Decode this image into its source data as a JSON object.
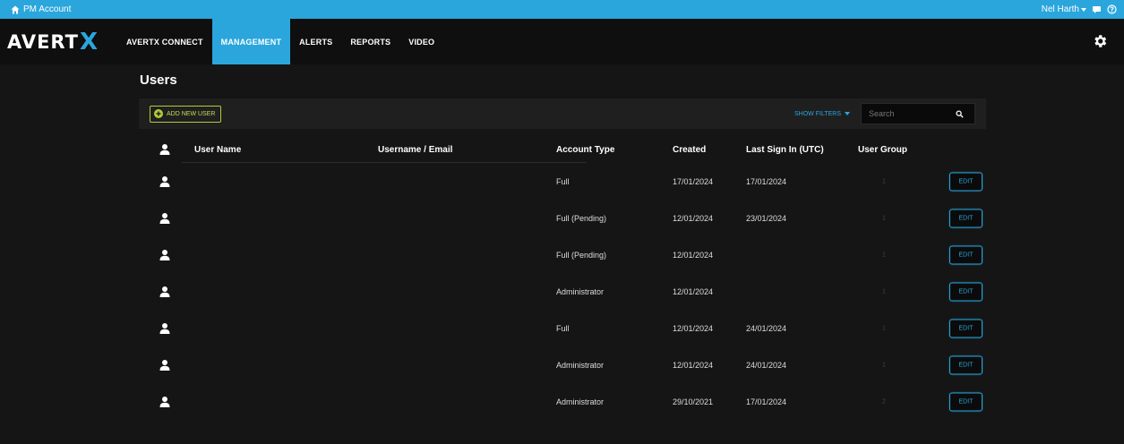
{
  "topbar": {
    "account_label": "PM Account",
    "user_name": "Nel Harth"
  },
  "nav": {
    "logo_main": "AVERT",
    "logo_x": "X",
    "tabs": [
      {
        "label": "AVERTX CONNECT"
      },
      {
        "label": "MANAGEMENT"
      },
      {
        "label": "ALERTS"
      },
      {
        "label": "REPORTS"
      },
      {
        "label": "VIDEO"
      }
    ],
    "active_tab": "MANAGEMENT"
  },
  "page": {
    "title": "Users"
  },
  "toolbar": {
    "add_label": "ADD NEW USER",
    "filters_label": "SHOW FILTERS",
    "search_placeholder": "Search"
  },
  "table": {
    "headers": {
      "user_name": "User Name",
      "email": "Username / Email",
      "account_type": "Account Type",
      "created": "Created",
      "last_sign_in": "Last Sign In (UTC)",
      "user_group": "User Group"
    },
    "edit_label": "EDIT",
    "rows": [
      {
        "account_type": "Full",
        "created": "17/01/2024",
        "last_sign_in": "17/01/2024",
        "group": "1"
      },
      {
        "account_type": "Full (Pending)",
        "created": "12/01/2024",
        "last_sign_in": "23/01/2024",
        "group": "1"
      },
      {
        "account_type": "Full (Pending)",
        "created": "12/01/2024",
        "last_sign_in": "",
        "group": "1"
      },
      {
        "account_type": "Administrator",
        "created": "12/01/2024",
        "last_sign_in": "",
        "group": "1"
      },
      {
        "account_type": "Full",
        "created": "12/01/2024",
        "last_sign_in": "24/01/2024",
        "group": "1"
      },
      {
        "account_type": "Administrator",
        "created": "12/01/2024",
        "last_sign_in": "24/01/2024",
        "group": "1"
      },
      {
        "account_type": "Administrator",
        "created": "29/10/2021",
        "last_sign_in": "17/01/2024",
        "group": "2"
      }
    ]
  },
  "colors": {
    "accent": "#2aa6dd",
    "add_button": "#b6c93a",
    "background": "#151515"
  }
}
